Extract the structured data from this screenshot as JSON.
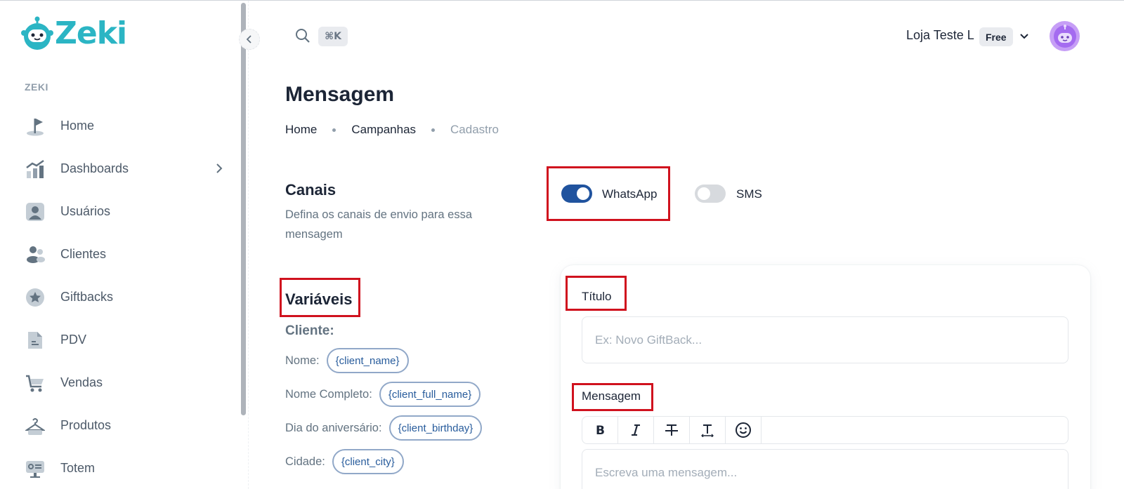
{
  "app": {
    "logo_text": "Zeki"
  },
  "sidebar": {
    "section_label": "ZEKI",
    "items": [
      {
        "label": "Home",
        "icon": "flag-icon"
      },
      {
        "label": "Dashboards",
        "icon": "chart-icon",
        "has_children": true
      },
      {
        "label": "Usuários",
        "icon": "user-card-icon"
      },
      {
        "label": "Clientes",
        "icon": "users-icon"
      },
      {
        "label": "Giftbacks",
        "icon": "star-icon"
      },
      {
        "label": "PDV",
        "icon": "document-icon"
      },
      {
        "label": "Vendas",
        "icon": "cart-icon"
      },
      {
        "label": "Produtos",
        "icon": "hanger-icon"
      },
      {
        "label": "Totem",
        "icon": "kiosk-icon"
      }
    ]
  },
  "header": {
    "search_shortcut": "⌘K",
    "store_name": "Loja Teste L",
    "plan_badge": "Free"
  },
  "page": {
    "title": "Mensagem",
    "breadcrumb": [
      "Home",
      "Campanhas",
      "Cadastro"
    ]
  },
  "canais": {
    "title": "Canais",
    "description": "Defina os canais de envio para essa mensagem",
    "channels": [
      {
        "label": "WhatsApp",
        "enabled": true
      },
      {
        "label": "SMS",
        "enabled": false
      }
    ]
  },
  "variaveis": {
    "title": "Variáveis",
    "group_label": "Cliente:",
    "items": [
      {
        "name": "Nome:",
        "token": "{client_name}"
      },
      {
        "name": "Nome Completo:",
        "token": "{client_full_name}"
      },
      {
        "name": "Dia do aniversário:",
        "token": "{client_birthday}"
      },
      {
        "name": "Cidade:",
        "token": "{client_city}"
      }
    ]
  },
  "form": {
    "titulo_label": "Título",
    "titulo_placeholder": "Ex: Novo GiftBack...",
    "mensagem_label": "Mensagem",
    "mensagem_placeholder": "Escreva uma mensagem...",
    "toolbar": [
      "bold-icon",
      "italic-icon",
      "strikethrough-icon",
      "clear-format-icon",
      "emoji-icon"
    ]
  },
  "colors": {
    "primary": "#20539e",
    "highlight_border": "#d0121e",
    "chip_border": "#91a8c8",
    "avatar": "#c69ef6",
    "brand": "#2bb5c4"
  }
}
